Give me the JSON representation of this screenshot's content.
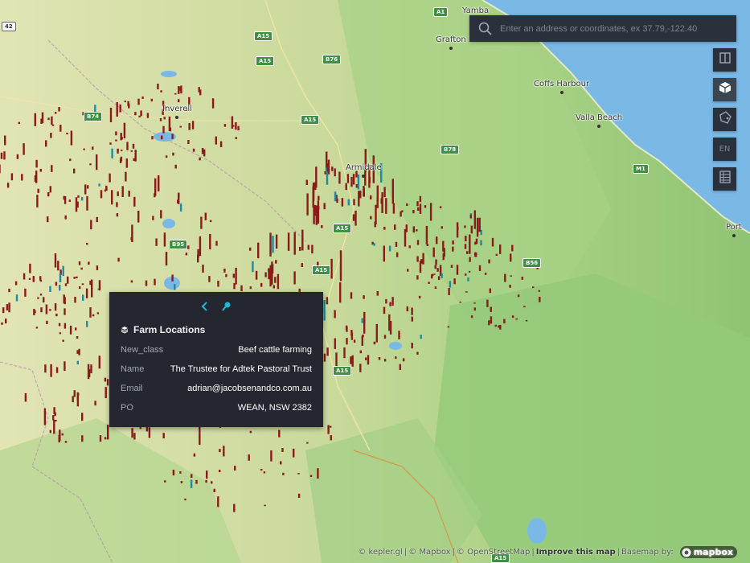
{
  "search": {
    "placeholder": "Enter an address or coordinates, ex 37.79,-122.40"
  },
  "controls": [
    {
      "name": "split-map",
      "icon": "split-map-icon"
    },
    {
      "name": "3d-view",
      "icon": "cube-icon",
      "active": true
    },
    {
      "name": "draw-polygon",
      "icon": "polygon-icon"
    },
    {
      "name": "language",
      "icon": "",
      "label": "EN"
    },
    {
      "name": "legend",
      "icon": "legend-icon"
    }
  ],
  "places": [
    {
      "name": "Yamba"
    },
    {
      "name": "Grafton"
    },
    {
      "name": "Coffs Harbour"
    },
    {
      "name": "Valla Beach"
    },
    {
      "name": "Inverell"
    },
    {
      "name": "Armidale"
    },
    {
      "name": "Port"
    }
  ],
  "roads": [
    "A1",
    "A15",
    "B76",
    "A15",
    "B74",
    "A15",
    "B78",
    "M1",
    "A15",
    "B95",
    "A15",
    "B56",
    "A15",
    "A15",
    "42"
  ],
  "tooltip": {
    "layer_name": "Farm Locations",
    "rows": [
      {
        "key": "New_class",
        "value": "Beef cattle farming"
      },
      {
        "key": "Name",
        "value": "The Trustee for Adtek Pastoral Trust"
      },
      {
        "key": "Email",
        "value": "adrian@jacobsenandco.com.au"
      },
      {
        "key": "PO",
        "value": "WEAN, NSW 2382"
      }
    ]
  },
  "attribution": {
    "kepler": "© kepler.gl",
    "mapbox": "© Mapbox",
    "osm": "© OpenStreetMap",
    "improve": "Improve this map",
    "basemap": "Basemap by:",
    "logo": "mapbox"
  },
  "colors": {
    "panel": "#29323c",
    "tooltip": "#242730",
    "ocean": "#7ab8e6",
    "land_dry": "#dfe3b0",
    "land_green": "#9cc97e",
    "farm_bar": "#8b1a1a",
    "accent": "#1fbad6"
  }
}
